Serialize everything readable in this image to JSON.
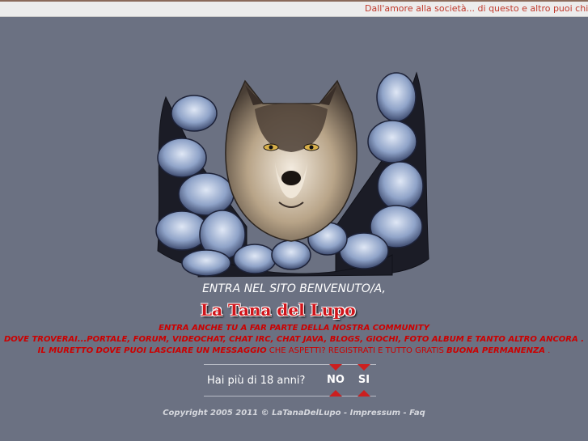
{
  "marquee": {
    "text": "Dall'amore alla società... di questo e altro puoi chiac"
  },
  "welcome": {
    "text": "ENTRA NEL SITO BENVENUTO/A,"
  },
  "logo": {
    "text": "La Tana del Lupo"
  },
  "promo": {
    "line1": "ENTRA ANCHE TU A FAR PARTE DELLA NOSTRA COMMUNITY",
    "line2": "DOVE TROVERAI...PORTALE, FORUM, VIDEOCHAT, CHAT IRC, CHAT JAVA, BLOGS, GIOCHI, FOTO ALBUM E TANTO ALTRO ANCORA .",
    "line3a": "IL MURETTO DOVE PUOI LASCIARE UN MESSAGGIO",
    "line3b": " CHE ASPETTI? REGISTRATI E TUTTO GRATIS ",
    "line3c": "BUONA PERMANENZA",
    "line3d": " ."
  },
  "age_check": {
    "question": "Hai più di 18 anni?",
    "no_label": "NO",
    "yes_label": "SI"
  },
  "footer": {
    "copyright": "Copyright  2005 2011 © LaTanaDelLupo - Impressum - Faq"
  },
  "colors": {
    "background": "#6b7182",
    "accent": "#cc0000",
    "marquee_bg": "#ececec"
  }
}
